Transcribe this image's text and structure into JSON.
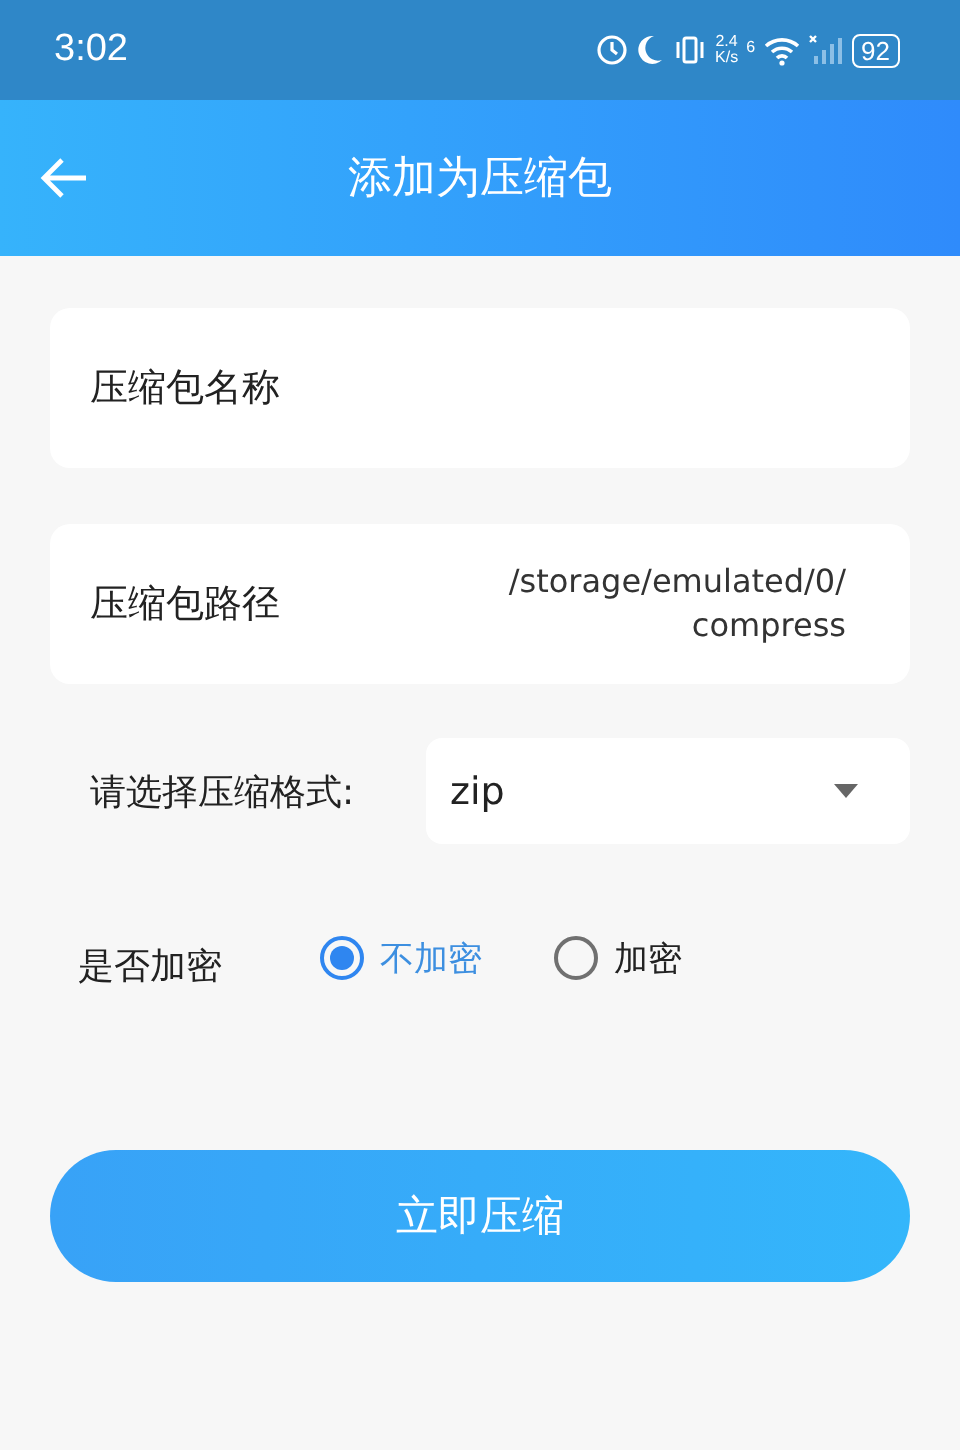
{
  "status_bar": {
    "time": "3:02",
    "speed_value": "2.4",
    "speed_unit": "K/s",
    "wifi_label": "6",
    "battery": "92"
  },
  "header": {
    "title": "添加为压缩包"
  },
  "fields": [
    {
      "label": "压缩包名称"
    },
    {
      "label": "压缩包路径",
      "value": "/storage/emulated/0/\ncompress"
    }
  ],
  "format": {
    "label": "请选择压缩格式:",
    "value": "zip"
  },
  "encryption": {
    "label": "是否加密",
    "options": [
      {
        "label": "不加密",
        "selected": true
      },
      {
        "label": "加密",
        "selected": false
      }
    ]
  },
  "submit_button": "立即压缩"
}
